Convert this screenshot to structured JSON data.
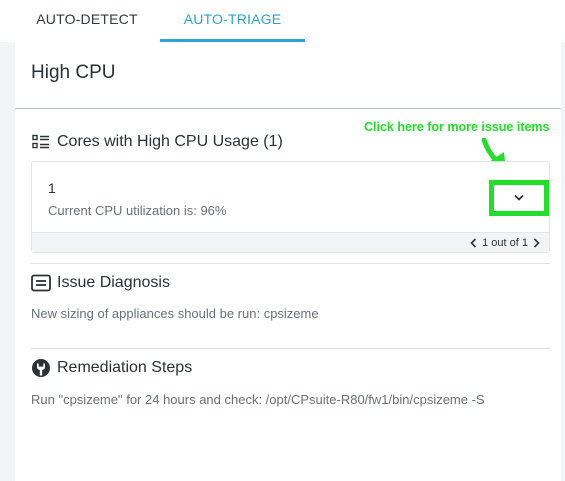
{
  "tabs": [
    {
      "label": "AUTO-DETECT",
      "active": false
    },
    {
      "label": "AUTO-TRIAGE",
      "active": true
    }
  ],
  "page": {
    "title": "High CPU"
  },
  "cores_section": {
    "heading": "Cores with High CPU Usage (1)",
    "issue": {
      "number": "1",
      "description": "Current CPU utilization is: 96%"
    },
    "pager": {
      "text": "1 out of 1"
    }
  },
  "annotation": {
    "text": "Click here for more issue items",
    "color": "#22e02a"
  },
  "diagnosis": {
    "heading": "Issue Diagnosis",
    "text": "New sizing of appliances should be run: cpsizeme"
  },
  "remediation": {
    "heading": "Remediation Steps",
    "text": "Run \"cpsizeme\" for 24 hours and check: /opt/CPsuite-R80/fw1/bin/cpsizeme -S"
  },
  "colors": {
    "accent": "#2ea2d1",
    "highlight": "#22e02a"
  },
  "icons": [
    "list-icon",
    "chevron-down-icon",
    "chevron-left-icon",
    "chevron-right-icon",
    "message-icon",
    "wrench-icon",
    "arrow-icon"
  ]
}
